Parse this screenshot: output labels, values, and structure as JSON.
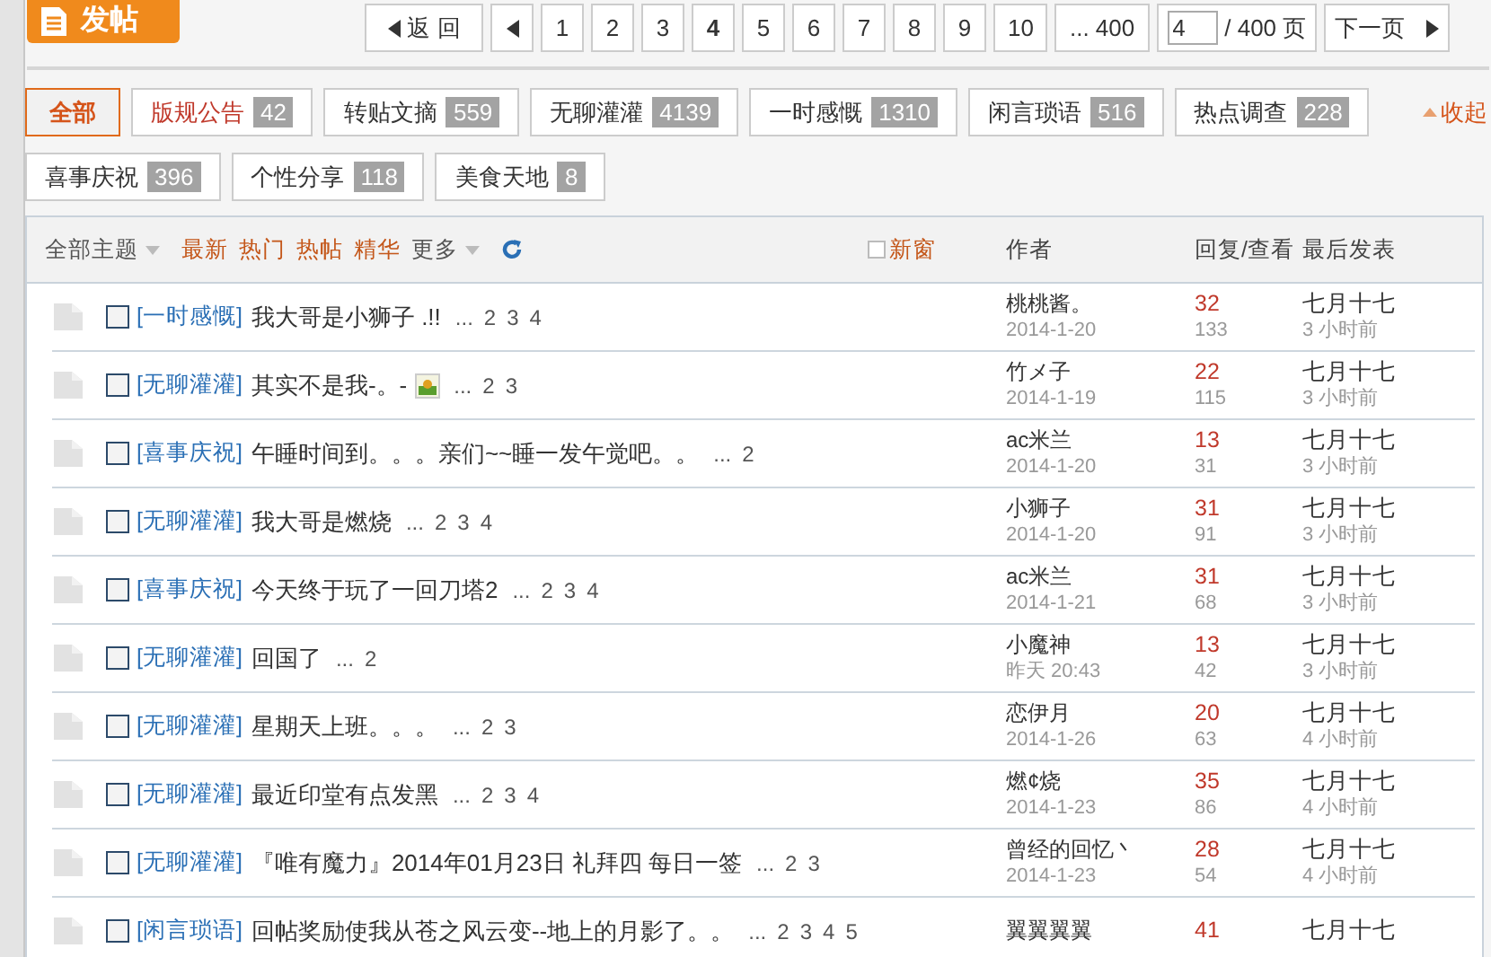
{
  "post_button": {
    "label": "发帖"
  },
  "pager": {
    "back": "返 回",
    "pages": [
      {
        "label": "1",
        "selected": false
      },
      {
        "label": "2",
        "selected": false
      },
      {
        "label": "3",
        "selected": false
      },
      {
        "label": "4",
        "selected": true
      },
      {
        "label": "5",
        "selected": false
      },
      {
        "label": "6",
        "selected": false
      },
      {
        "label": "7",
        "selected": false
      },
      {
        "label": "8",
        "selected": false
      },
      {
        "label": "9",
        "selected": false
      },
      {
        "label": "10",
        "selected": false
      },
      {
        "label": "... 400",
        "selected": false
      }
    ],
    "page_input": "4",
    "total": "/ 400 页",
    "next": "下一页"
  },
  "filters": [
    {
      "label": "全部",
      "selected": true
    },
    {
      "label": "版规公告",
      "count": "42",
      "selected": false,
      "color": "#c0392b"
    },
    {
      "label": "转贴文摘",
      "count": "559",
      "selected": false,
      "color": "#333333"
    },
    {
      "label": "无聊灌灌",
      "count": "4139",
      "selected": false,
      "color": "#333333"
    },
    {
      "label": "一时感慨",
      "count": "1310",
      "selected": false,
      "color": "#333333"
    },
    {
      "label": "闲言琐语",
      "count": "516",
      "selected": false,
      "color": "#333333"
    },
    {
      "label": "热点调查",
      "count": "228",
      "selected": false,
      "color": "#333333"
    },
    {
      "label": "喜事庆祝",
      "count": "396",
      "selected": false,
      "color": "#333333"
    },
    {
      "label": "个性分享",
      "count": "118",
      "selected": false,
      "color": "#333333"
    },
    {
      "label": "美食天地",
      "count": "8",
      "selected": false,
      "color": "#333333"
    }
  ],
  "collapse": "收起",
  "toolbar": {
    "all_topics": "全部主题",
    "sorts": [
      "最新",
      "热门",
      "热帖",
      "精华"
    ],
    "more": "更多",
    "new_window": {
      "label": "新窗",
      "checked": false
    }
  },
  "columns": [
    "作者",
    "回复/查看",
    "最后发表"
  ],
  "threads": [
    {
      "checked": false,
      "category": "[一时感慨]",
      "title": "我大哥是小狮子 .!!",
      "has_image": false,
      "ellipsis": "...",
      "pages": [
        "2",
        "3",
        "4"
      ],
      "author": "桃桃酱。",
      "date": "2014-1-20",
      "replies": "32",
      "views": "133",
      "last": "七月十七",
      "last_time": "3 小时前"
    },
    {
      "checked": false,
      "category": "[无聊灌灌]",
      "title": "其实不是我-。-",
      "has_image": true,
      "ellipsis": "...",
      "pages": [
        "2",
        "3"
      ],
      "author": "竹メ子",
      "date": "2014-1-19",
      "replies": "22",
      "views": "115",
      "last": "七月十七",
      "last_time": "3 小时前"
    },
    {
      "checked": false,
      "category": "[喜事庆祝]",
      "title": "午睡时间到。。。亲们~~睡一发午觉吧。。",
      "has_image": false,
      "ellipsis": "...",
      "pages": [
        "2"
      ],
      "author": "ac米兰",
      "date": "2014-1-20",
      "replies": "13",
      "views": "31",
      "last": "七月十七",
      "last_time": "3 小时前"
    },
    {
      "checked": false,
      "category": "[无聊灌灌]",
      "title": "我大哥是燃烧",
      "has_image": false,
      "ellipsis": "...",
      "pages": [
        "2",
        "3",
        "4"
      ],
      "author": "小狮子",
      "date": "2014-1-20",
      "replies": "31",
      "views": "91",
      "last": "七月十七",
      "last_time": "3 小时前"
    },
    {
      "checked": false,
      "category": "[喜事庆祝]",
      "title": "今天终于玩了一回刀塔2",
      "has_image": false,
      "ellipsis": "...",
      "pages": [
        "2",
        "3",
        "4"
      ],
      "author": "ac米兰",
      "date": "2014-1-21",
      "replies": "31",
      "views": "68",
      "last": "七月十七",
      "last_time": "3 小时前"
    },
    {
      "checked": false,
      "category": "[无聊灌灌]",
      "title": "回国了",
      "has_image": false,
      "ellipsis": "...",
      "pages": [
        "2"
      ],
      "author": "小魔神",
      "date": "昨天 20:43",
      "replies": "13",
      "views": "42",
      "last": "七月十七",
      "last_time": "3 小时前"
    },
    {
      "checked": false,
      "category": "[无聊灌灌]",
      "title": "星期天上班。。。",
      "has_image": false,
      "ellipsis": "...",
      "pages": [
        "2",
        "3"
      ],
      "author": "恋伊月",
      "date": "2014-1-26",
      "replies": "20",
      "views": "63",
      "last": "七月十七",
      "last_time": "4 小时前"
    },
    {
      "checked": false,
      "category": "[无聊灌灌]",
      "title": "最近印堂有点发黑",
      "has_image": false,
      "ellipsis": "...",
      "pages": [
        "2",
        "3",
        "4"
      ],
      "author": "燃¢烧",
      "date": "2014-1-23",
      "replies": "35",
      "views": "86",
      "last": "七月十七",
      "last_time": "4 小时前"
    },
    {
      "checked": false,
      "category": "[无聊灌灌]",
      "title": "『唯有魔力』2014年01月23日 礼拜四 每日一签",
      "has_image": false,
      "ellipsis": "...",
      "pages": [
        "2",
        "3"
      ],
      "author": "曾经的回忆丶",
      "date": "2014-1-23",
      "replies": "28",
      "views": "54",
      "last": "七月十七",
      "last_time": "4 小时前"
    },
    {
      "checked": false,
      "category": "[闲言琐语]",
      "title": "回帖奖励使我从苍之风云变--地上的月影了。。",
      "has_image": false,
      "ellipsis": "...",
      "pages": [
        "2",
        "3",
        "4",
        "5"
      ],
      "author": "翼翼翼翼",
      "replies": "41",
      "last": "七月十七"
    }
  ]
}
